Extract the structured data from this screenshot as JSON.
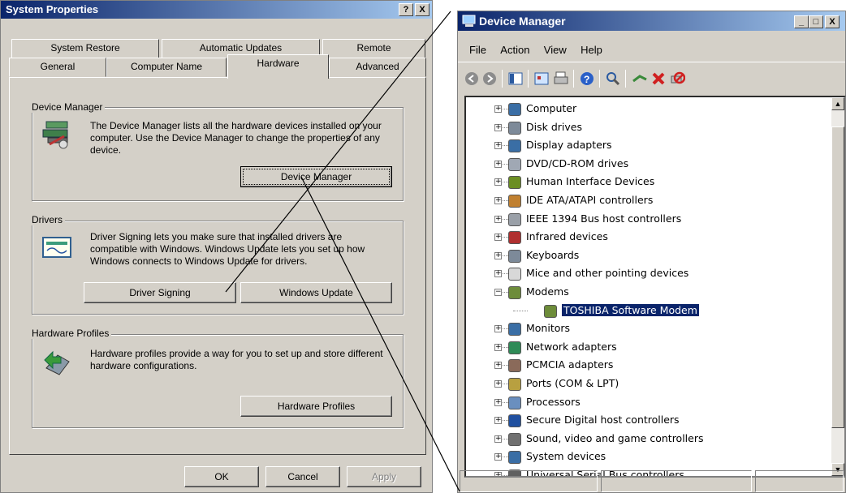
{
  "system_properties": {
    "title": "System Properties",
    "help_btn": "?",
    "close_btn": "X",
    "tabs_row1": [
      "System Restore",
      "Automatic Updates",
      "Remote"
    ],
    "tabs_row2": [
      "General",
      "Computer Name",
      "Hardware",
      "Advanced"
    ],
    "device_manager_group": {
      "legend": "Device Manager",
      "description": "The Device Manager lists all the hardware devices installed on your computer. Use the Device Manager to change the properties of any device.",
      "button": "Device Manager"
    },
    "drivers_group": {
      "legend": "Drivers",
      "description": "Driver Signing lets you make sure that installed drivers are compatible with Windows. Windows Update lets you set up how Windows connects to Windows Update for drivers.",
      "button1": "Driver Signing",
      "button2": "Windows Update"
    },
    "hardware_profiles_group": {
      "legend": "Hardware Profiles",
      "description": "Hardware profiles provide a way for you to set up and store different hardware configurations.",
      "button": "Hardware Profiles"
    },
    "ok": "OK",
    "cancel": "Cancel",
    "apply": "Apply"
  },
  "device_manager": {
    "title": "Device Manager",
    "min_btn": "_",
    "max_btn": "□",
    "close_btn": "X",
    "menu": [
      "File",
      "Action",
      "View",
      "Help"
    ],
    "tree": [
      {
        "label": "Computer",
        "icon": "computer-icon",
        "color": "#3a6ea5"
      },
      {
        "label": "Disk drives",
        "icon": "disk-drive-icon",
        "color": "#7d8a99"
      },
      {
        "label": "Display adapters",
        "icon": "display-adapter-icon",
        "color": "#3a6ea5"
      },
      {
        "label": "DVD/CD-ROM drives",
        "icon": "dvd-drive-icon",
        "color": "#a0a8b4"
      },
      {
        "label": "Human Interface Devices",
        "icon": "hid-icon",
        "color": "#6b8e23"
      },
      {
        "label": "IDE ATA/ATAPI controllers",
        "icon": "ide-controller-icon",
        "color": "#c08030"
      },
      {
        "label": "IEEE 1394 Bus host controllers",
        "icon": "ieee1394-icon",
        "color": "#9aa0a8"
      },
      {
        "label": "Infrared devices",
        "icon": "infrared-icon",
        "color": "#b03030"
      },
      {
        "label": "Keyboards",
        "icon": "keyboard-icon",
        "color": "#7d8a99"
      },
      {
        "label": "Mice and other pointing devices",
        "icon": "mouse-icon",
        "color": "#d8d8d8"
      },
      {
        "label": "Modems",
        "icon": "modem-icon",
        "color": "#6d8c3a",
        "expanded": true
      },
      {
        "label": "TOSHIBA Software Modem",
        "icon": "modem-icon",
        "color": "#6d8c3a",
        "child": true,
        "selected": true
      },
      {
        "label": "Monitors",
        "icon": "monitor-icon",
        "color": "#3a6ea5"
      },
      {
        "label": "Network adapters",
        "icon": "network-adapter-icon",
        "color": "#2e8b57"
      },
      {
        "label": "PCMCIA adapters",
        "icon": "pcmcia-icon",
        "color": "#8a6a5a"
      },
      {
        "label": "Ports (COM & LPT)",
        "icon": "port-icon",
        "color": "#b8a040"
      },
      {
        "label": "Processors",
        "icon": "processor-icon",
        "color": "#6a8fbf"
      },
      {
        "label": "Secure Digital host controllers",
        "icon": "sd-controller-icon",
        "color": "#2050a0"
      },
      {
        "label": "Sound, video and game controllers",
        "icon": "sound-icon",
        "color": "#707070"
      },
      {
        "label": "System devices",
        "icon": "system-device-icon",
        "color": "#3a6ea5"
      },
      {
        "label": "Universal Serial Bus controllers",
        "icon": "usb-icon",
        "color": "#606060"
      }
    ]
  }
}
